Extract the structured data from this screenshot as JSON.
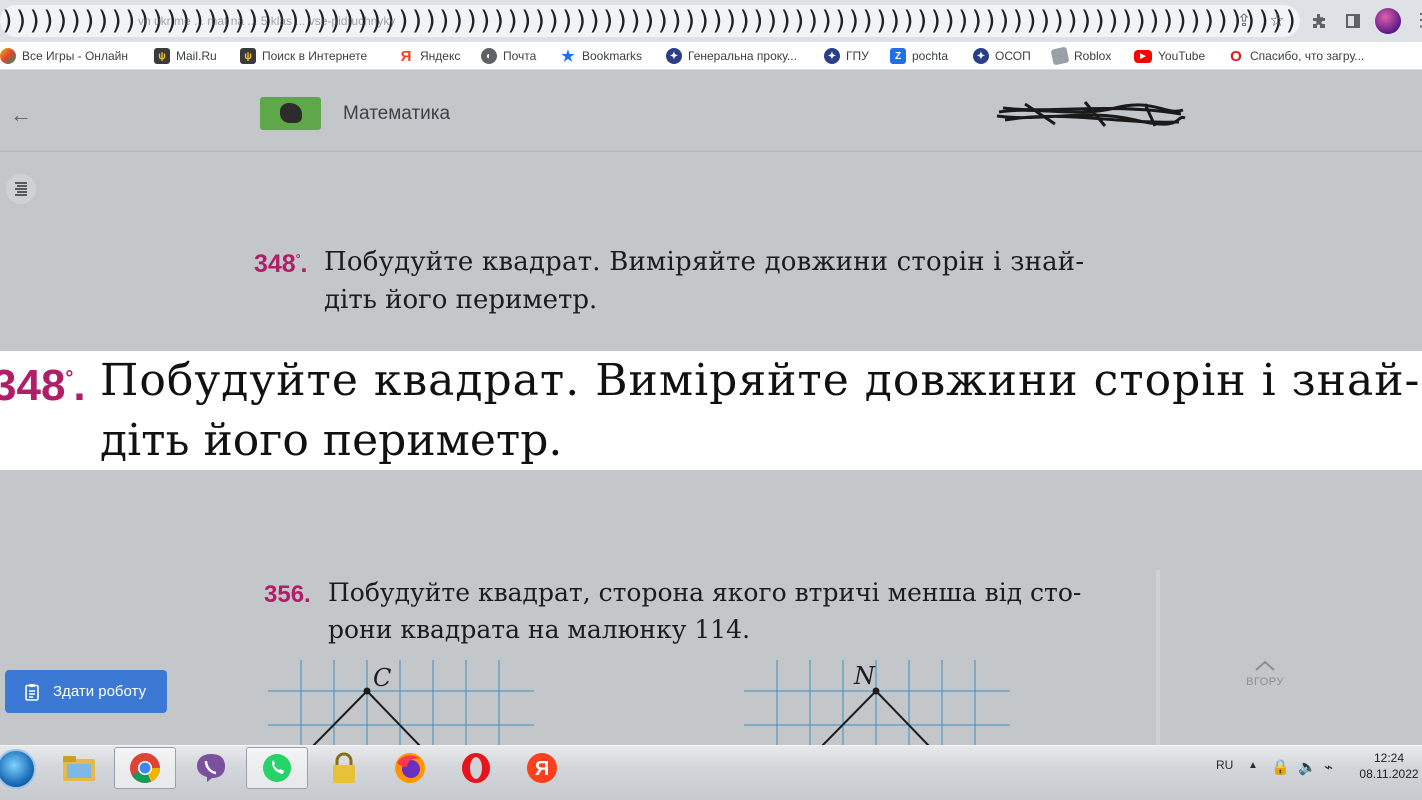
{
  "browser": {
    "address_noise": ")))))))))))))))))))))))))))))))))))))))))))))))))))))))))))))))))))))))))))))))))))))))))))))))))))))))))))))))))))))))))))))))))))))",
    "url_ghost": "vn ukr me ... mat na ... 5 klas ... vse-pidruchnyky"
  },
  "bookmarks": [
    {
      "label": "Все Игры - Онлайн",
      "icon": "games-icon",
      "color": "#f4b400"
    },
    {
      "label": "Mail.Ru",
      "icon": "trident-icon",
      "color": "#3a3a3a"
    },
    {
      "label": "Поиск в Интернете",
      "icon": "trident-icon",
      "color": "#3a3a3a"
    },
    {
      "label": "Яндекс",
      "icon": "yandex-icon",
      "color": "#fc3f1d"
    },
    {
      "label": "Почта",
      "icon": "globe-icon",
      "color": "#5f6368"
    },
    {
      "label": "Bookmarks",
      "icon": "star-icon",
      "color": "#1a73e8"
    },
    {
      "label": "Генеральна проку...",
      "icon": "emblem-icon",
      "color": "#2a3f87"
    },
    {
      "label": "ГПУ",
      "icon": "emblem-icon",
      "color": "#2a3f87"
    },
    {
      "label": "pochta",
      "icon": "z-icon",
      "color": "#1f6feb"
    },
    {
      "label": "ОСОП",
      "icon": "emblem-icon",
      "color": "#2a3f87"
    },
    {
      "label": "Roblox",
      "icon": "roblox-icon",
      "color": "#9aa0a6"
    },
    {
      "label": "YouTube",
      "icon": "youtube-icon",
      "color": "#ff0000"
    },
    {
      "label": "Спасибо, что загру...",
      "icon": "opera-icon",
      "color": "#e8141b"
    }
  ],
  "header": {
    "subject": "Математика"
  },
  "exercises": {
    "ex348": {
      "number": "348",
      "mark": "°",
      "line1": "Побудуйте квадрат. Виміряйте довжини сторін і знай-",
      "line2": "діть його периметр."
    },
    "ex356": {
      "number": "356.",
      "line1": "Побудуйте квадрат, сторона якого втричі менша від сто-",
      "line2": "рони квадрата на малюнку 114."
    }
  },
  "figures": {
    "left_label": "C",
    "right_label": "N"
  },
  "buttons": {
    "submit": "Здати роботу",
    "to_top": "ВГОРУ"
  },
  "taskbar": {
    "lang": "RU",
    "time": "12:24",
    "date": "08.11.2022"
  },
  "colors": {
    "exercise_number": "#b01e68",
    "submit_button": "#3b79d4",
    "page_background": "#c4c7ca"
  }
}
